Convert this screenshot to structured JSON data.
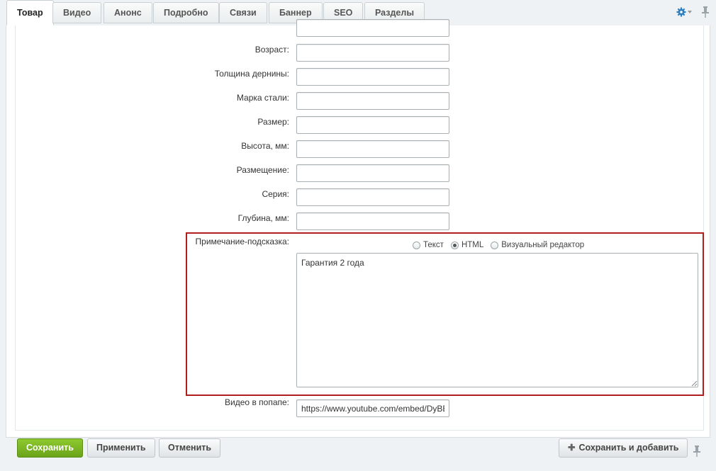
{
  "tabs": [
    {
      "label": "Товар",
      "active": true
    },
    {
      "label": "Видео"
    },
    {
      "label": "Анонс"
    },
    {
      "label": "Подробно"
    },
    {
      "label": "Связи"
    },
    {
      "label": "Баннер"
    },
    {
      "label": "SEO"
    },
    {
      "label": "Разделы"
    }
  ],
  "fields": [
    {
      "label": "Возраст:",
      "value": ""
    },
    {
      "label": "Толщина дернины:",
      "value": ""
    },
    {
      "label": "Марка стали:",
      "value": ""
    },
    {
      "label": "Размер:",
      "value": ""
    },
    {
      "label": "Высота, мм:",
      "value": ""
    },
    {
      "label": "Размещение:",
      "value": ""
    },
    {
      "label": "Серия:",
      "value": ""
    },
    {
      "label": "Глубина, мм:",
      "value": ""
    }
  ],
  "note": {
    "label": "Примечание-подсказка:",
    "modes": [
      "Текст",
      "HTML",
      "Визуальный редактор"
    ],
    "selected_mode": "HTML",
    "value": "Гарантия 2 года"
  },
  "video_popup": {
    "label": "Видео в попапе:",
    "value": "https://www.youtube.com/embed/DyBBE"
  },
  "footer": {
    "save": "Сохранить",
    "apply": "Применить",
    "cancel": "Отменить",
    "save_add": "Сохранить и добавить"
  },
  "colors": {
    "accent": "#6aa319",
    "highlight": "#b01d1d",
    "gear": "#2f7fc1"
  },
  "icons": [
    "gear-icon",
    "pin-icon",
    "plus-icon"
  ]
}
